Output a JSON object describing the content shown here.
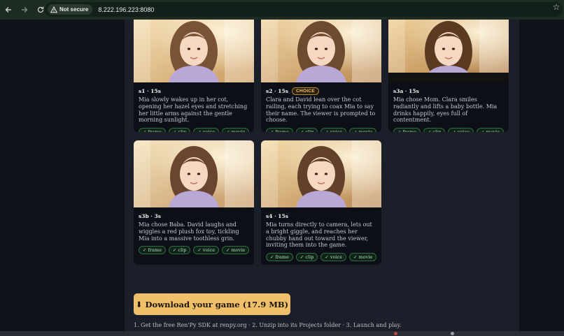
{
  "browser": {
    "security_label": "Not secure",
    "url": "8.222.196.223:8080",
    "icons": [
      "back-arrow-icon",
      "forward-arrow-icon",
      "reload-icon",
      "warning-icon",
      "star-icon"
    ]
  },
  "scenes": [
    {
      "id": "s1",
      "duration": "15s",
      "choice": "",
      "description": "Mia slowly wakes up in her cot, opening her hazel eyes and stretching her little arms against the gentle morning sunlight.",
      "assets": [
        "✓ frame",
        "✓ clip",
        "✓ voice",
        "✓ movie"
      ]
    },
    {
      "id": "s2",
      "duration": "15s",
      "choice": "CHOICE",
      "description": "Clara and David lean over the cot railing, each trying to coax Mia to say their name. The viewer is prompted to choose.",
      "assets": [
        "✓ frame",
        "✓ clip",
        "✓ voice",
        "✓ movie"
      ]
    },
    {
      "id": "s3a",
      "duration": "15s",
      "choice": "",
      "description": "Mia chose Mom. Clara smiles radiantly and lifts a baby bottle. Mia drinks happily, eyes full of contentment.",
      "assets": [
        "✓ frame",
        "✓ clip",
        "✓ voice",
        "✓ movie"
      ]
    },
    {
      "id": "s3b",
      "duration": "3s",
      "choice": "",
      "description": "Mia chose Baba. David laughs and wiggles a red plush fox toy, tickling Mia into a massive toothless grin.",
      "assets": [
        "✓ frame",
        "✓ clip",
        "✓ voice",
        "✓ movie"
      ]
    },
    {
      "id": "s4",
      "duration": "15s",
      "choice": "",
      "description": "Mia turns directly to camera, lets out a bright giggle, and reaches her chubby hand out toward the viewer, inviting them into the game.",
      "assets": [
        "✓ frame",
        "✓ clip",
        "✓ voice",
        "✓ movie"
      ]
    }
  ],
  "meta_separator": " · ",
  "download": {
    "label": "⬇ Download your game (17.9 MB)",
    "steps": "1. Get the free Ren'Py SDK at renpy.org  ·  2. Unzip into its Projects folder  ·  3. Launch and play."
  },
  "colors": {
    "accent": "#f0bf6a",
    "badge_text": "#a6e0b4",
    "choice": "#f0c057"
  }
}
